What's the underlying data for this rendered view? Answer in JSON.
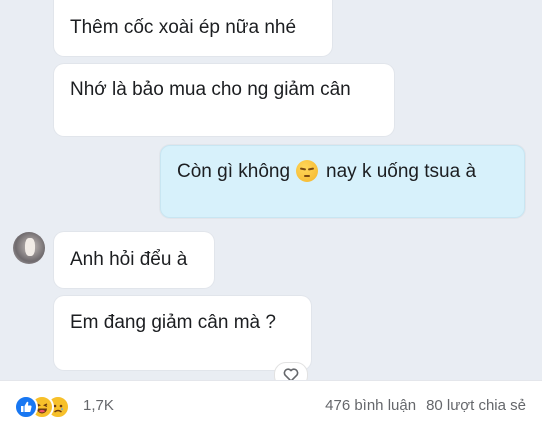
{
  "messages": {
    "m1": "Thêm cốc xoài ép nữa nhé",
    "m2": "Nhớ là bảo mua cho ng giảm cân",
    "m3_before": "Còn gì không",
    "m3_after": "nay k uống tsua à",
    "m4": "Anh hỏi đểu à",
    "m5": "Em đang giảm cân mà ?"
  },
  "emoji": "pensive-face-icon",
  "footer": {
    "reaction_count": "1,7K",
    "comments": "476 bình luận",
    "shares": "80 lượt chia sẻ",
    "reaction_icons": [
      "like-icon",
      "haha-icon",
      "sad-icon"
    ]
  },
  "colors": {
    "incoming_bubble": "#ffffff",
    "outgoing_bubble": "#d7f1fb",
    "chat_background": "#e9edf3",
    "like_blue": "#1877f2"
  }
}
